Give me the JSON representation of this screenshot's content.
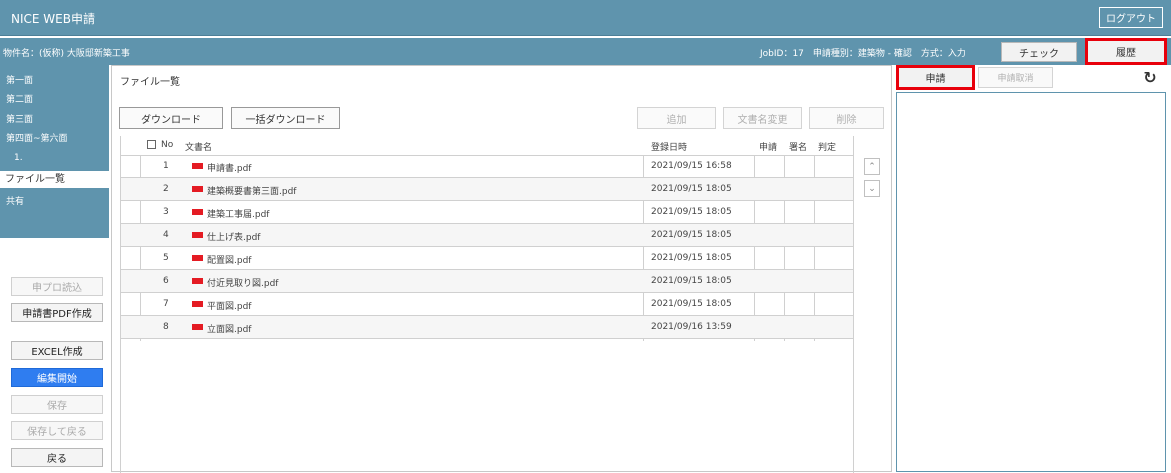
{
  "header": {
    "app_title": "NICE WEB申請",
    "logout_label": "ログアウト"
  },
  "infobar": {
    "job_name": "物件名：(仮称) 大阪邸新築工事",
    "job_info": "JobID：17　申請種別：建築物 - 確認　方式：入力",
    "check_label": "チェック",
    "history_label": "履歴"
  },
  "sidebar": {
    "items": [
      {
        "label": "第一面",
        "active": false
      },
      {
        "label": "第二面",
        "active": false
      },
      {
        "label": "第三面",
        "active": false
      },
      {
        "label": "第四面~第六面",
        "active": false
      },
      {
        "label": "1.",
        "active": false
      },
      {
        "label": "ファイル一覧",
        "active": true
      },
      {
        "label": "共有",
        "active": false
      }
    ],
    "buttons": {
      "load_label": "申プロ読込",
      "pdf_label": "申請書PDF作成",
      "excel_label": "EXCEL作成",
      "edit_label": "編集開始",
      "save_label": "保存",
      "save_back_label": "保存して戻る",
      "back_label": "戻る"
    }
  },
  "main": {
    "title": "ファイル一覧",
    "toolbar": {
      "download_label": "ダウンロード",
      "bulk_download_label": "一括ダウンロード",
      "add_label": "追加",
      "rename_label": "文書名変更",
      "delete_label": "削除"
    },
    "columns": {
      "no": "No",
      "doc_name": "文書名",
      "date": "登録日時",
      "apply": "申請",
      "sign": "署名",
      "judge": "判定"
    },
    "rows": [
      {
        "no": "1",
        "name": "申請書.pdf",
        "date": "2021/09/15 16:58"
      },
      {
        "no": "2",
        "name": "建築概要書第三面.pdf",
        "date": "2021/09/15 18:05"
      },
      {
        "no": "3",
        "name": "建築工事届.pdf",
        "date": "2021/09/15 18:05"
      },
      {
        "no": "4",
        "name": "仕上げ表.pdf",
        "date": "2021/09/15 18:05"
      },
      {
        "no": "5",
        "name": "配置図.pdf",
        "date": "2021/09/15 18:05"
      },
      {
        "no": "6",
        "name": "付近見取り図.pdf",
        "date": "2021/09/15 18:05"
      },
      {
        "no": "7",
        "name": "平面図.pdf",
        "date": "2021/09/15 18:05"
      },
      {
        "no": "8",
        "name": "立面図.pdf",
        "date": "2021/09/16 13:59"
      }
    ]
  },
  "right_panel": {
    "apply_tab_label": "申請",
    "cancel_tab_label": "申請取消"
  },
  "colors": {
    "brand": "#5f94ad",
    "highlight": "#e8000b",
    "primary_button": "#2f7df0",
    "pdf_icon": "#e41b23"
  }
}
